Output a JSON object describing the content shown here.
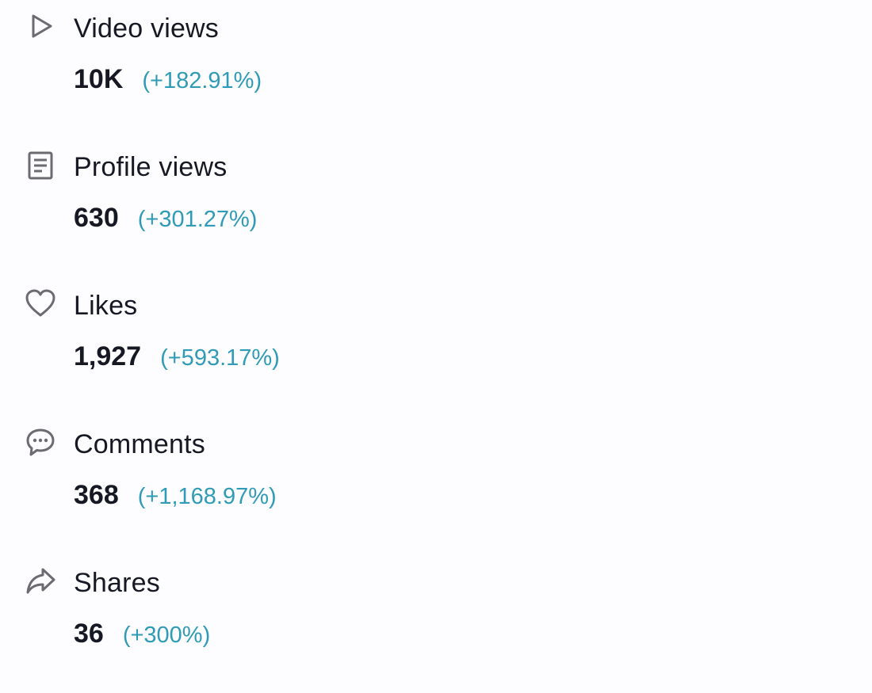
{
  "metrics": [
    {
      "icon": "play-icon",
      "label": "Video views",
      "value": "10K",
      "change": "(+182.91%)"
    },
    {
      "icon": "document-icon",
      "label": "Profile views",
      "value": "630",
      "change": "(+301.27%)"
    },
    {
      "icon": "heart-icon",
      "label": "Likes",
      "value": "1,927",
      "change": "(+593.17%)"
    },
    {
      "icon": "comment-icon",
      "label": "Comments",
      "value": "368",
      "change": "(+1,168.97%)"
    },
    {
      "icon": "share-icon",
      "label": "Shares",
      "value": "36",
      "change": "(+300%)"
    }
  ],
  "colors": {
    "text": "#161823",
    "change": "#2f9bb7",
    "icon": "#6b6b70",
    "background": "#fdfcfe"
  }
}
